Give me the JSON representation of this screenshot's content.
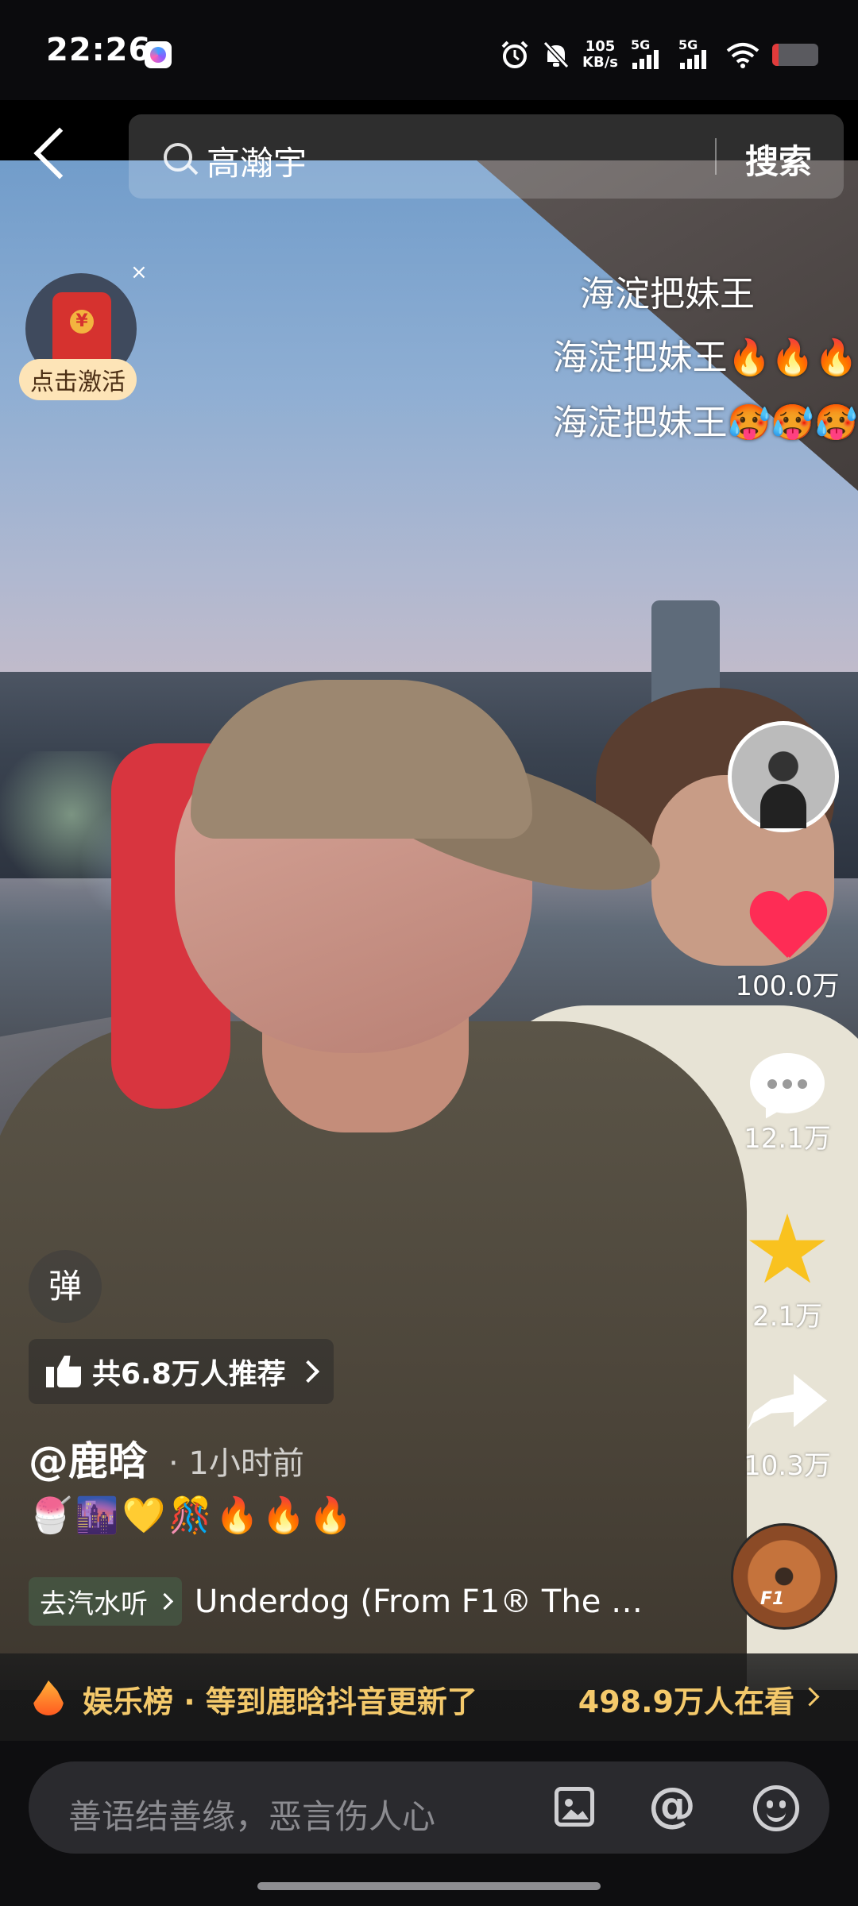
{
  "status_bar": {
    "time": "22:26",
    "net_speed_value": "105",
    "net_speed_unit": "KB/s",
    "sim1_label": "5G",
    "sim2_label": "5G"
  },
  "search": {
    "query": "高瀚宇",
    "button_label": "搜索"
  },
  "red_packet": {
    "label": "点击激活",
    "close_symbol": "×"
  },
  "captions": [
    "海淀把妹王",
    "海淀把妹王🔥🔥🔥",
    "海淀把妹王🥵🥵🥵"
  ],
  "actions": {
    "likes": "100.0万",
    "comments": "12.1万",
    "favorites": "2.1万",
    "shares": "10.3万"
  },
  "video_info": {
    "danmu_label": "弹",
    "recommend_text": "共6.8万人推荐",
    "author": "@鹿晗",
    "time_ago": "· 1小时前",
    "description": "🍧🌆💛🎊🔥🔥🔥",
    "music_tag": "去汽水听",
    "music_title": "Underdog (From F1® The …"
  },
  "trending": {
    "text": "娱乐榜 · 等到鹿晗抖音更新了",
    "viewers": "498.9万人在看"
  },
  "comment_input": {
    "placeholder": "善语结善缘，恶言伤人心"
  },
  "colors": {
    "like_red": "#fe2c55",
    "star_yellow": "#f9c21f",
    "trend_gold": "#f4c96b"
  }
}
